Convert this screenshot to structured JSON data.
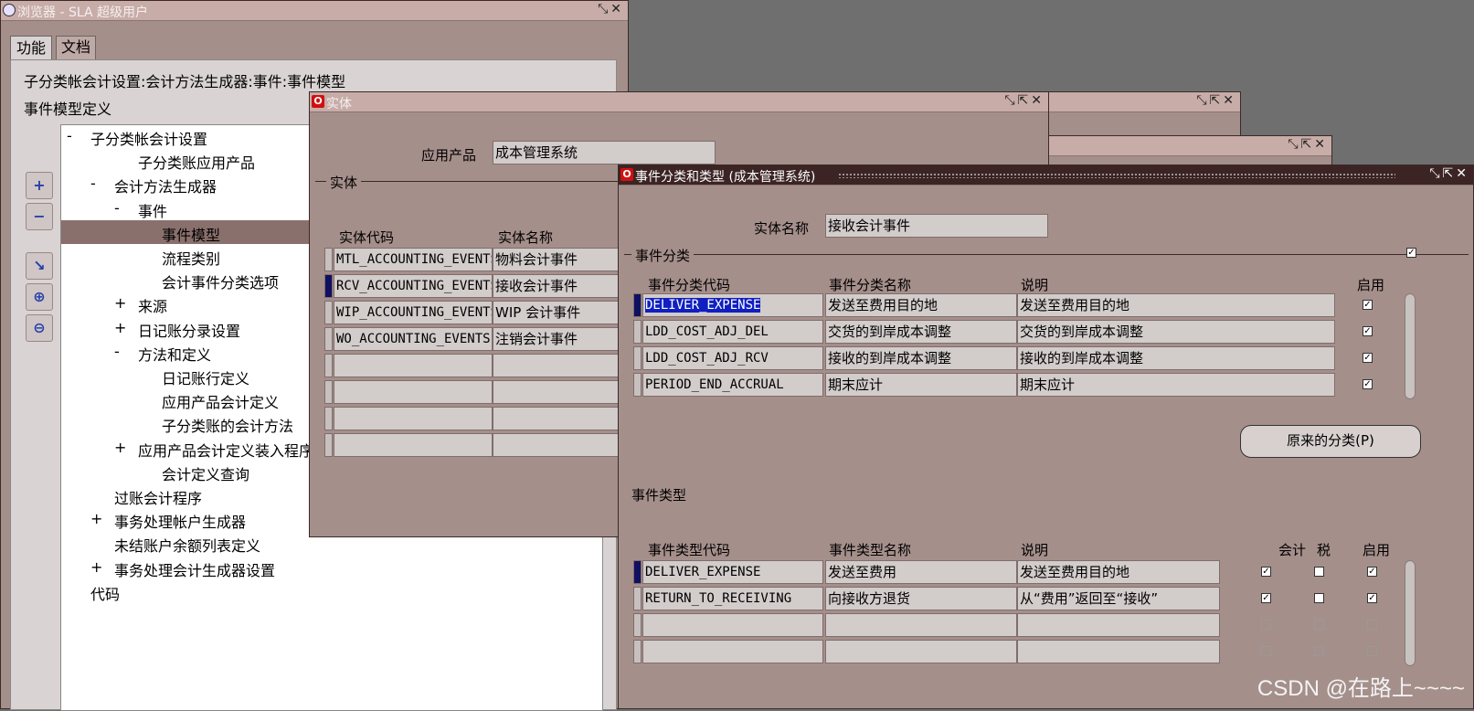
{
  "nav_window": {
    "title": "浏览器 - SLA 超级用户",
    "tabs": [
      "功能",
      "文档"
    ],
    "breadcrumb": "子分类帐会计设置:会计方法生成器:事件:事件模型",
    "section_title": "事件模型定义",
    "tree": [
      "子分类帐会计设置",
      "子分类账应用产品",
      "会计方法生成器",
      "事件",
      "事件模型",
      "流程类别",
      "会计事件分类选项",
      "来源",
      "日记账分录设置",
      "方法和定义",
      "日记账行定义",
      "应用产品会计定义",
      "子分类账的会计方法",
      "应用产品会计定义装入程序",
      "会计定义查询",
      "过账会计程序",
      "事务处理帐户生成器",
      "未结账户余额列表定义",
      "事务处理会计生成器设置",
      "代码"
    ],
    "tree_markers": [
      "-",
      "",
      "-",
      "-",
      "",
      "",
      "",
      "+",
      "+",
      "-",
      "",
      "",
      "",
      "+",
      "",
      "",
      "+",
      "",
      "+",
      ""
    ]
  },
  "entity_window": {
    "title": "实体",
    "app_label": "应用产品",
    "app_value": "成本管理系统",
    "section": "实体",
    "headers": [
      "实体代码",
      "实体名称"
    ],
    "rows": [
      [
        "MTL_ACCOUNTING_EVENTS",
        "物料会计事件"
      ],
      [
        "RCV_ACCOUNTING_EVENTS",
        "接收会计事件"
      ],
      [
        "WIP_ACCOUNTING_EVENTS",
        "WIP 会计事件"
      ],
      [
        "WO_ACCOUNTING_EVENTS",
        "注销会计事件"
      ]
    ]
  },
  "event_window": {
    "title": "事件分类和类型 (成本管理系统)",
    "entity_label": "实体名称",
    "entity_value": "接收会计事件",
    "class_section": "事件分类",
    "class_headers": [
      "事件分类代码",
      "事件分类名称",
      "说明",
      "启用"
    ],
    "class_rows": [
      [
        "DELIVER_EXPENSE",
        "发送至费用目的地",
        "发送至费用目的地"
      ],
      [
        "LDD_COST_ADJ_DEL",
        "交货的到岸成本调整",
        "交货的到岸成本调整"
      ],
      [
        "LDD_COST_ADJ_RCV",
        "接收的到岸成本调整",
        "接收的到岸成本调整"
      ],
      [
        "PERIOD_END_ACCRUAL",
        "期末应计",
        "期末应计"
      ]
    ],
    "orig_class_button": "原来的分类(P)",
    "type_section": "事件类型",
    "type_headers": [
      "事件类型代码",
      "事件类型名称",
      "说明",
      "会计",
      "税",
      "启用"
    ],
    "type_rows": [
      [
        "DELIVER_EXPENSE",
        "发送至费用",
        "发送至费用目的地"
      ],
      [
        "RETURN_TO_RECEIVING",
        "向接收方退货",
        "从“费用”返回至“接收”"
      ]
    ]
  },
  "watermark": "CSDN @在路上~~~~",
  "colors": {
    "window_bg": "#a58f8b",
    "field": "#d2cccb",
    "active_title": "#3c2424",
    "selection": "#101060"
  }
}
